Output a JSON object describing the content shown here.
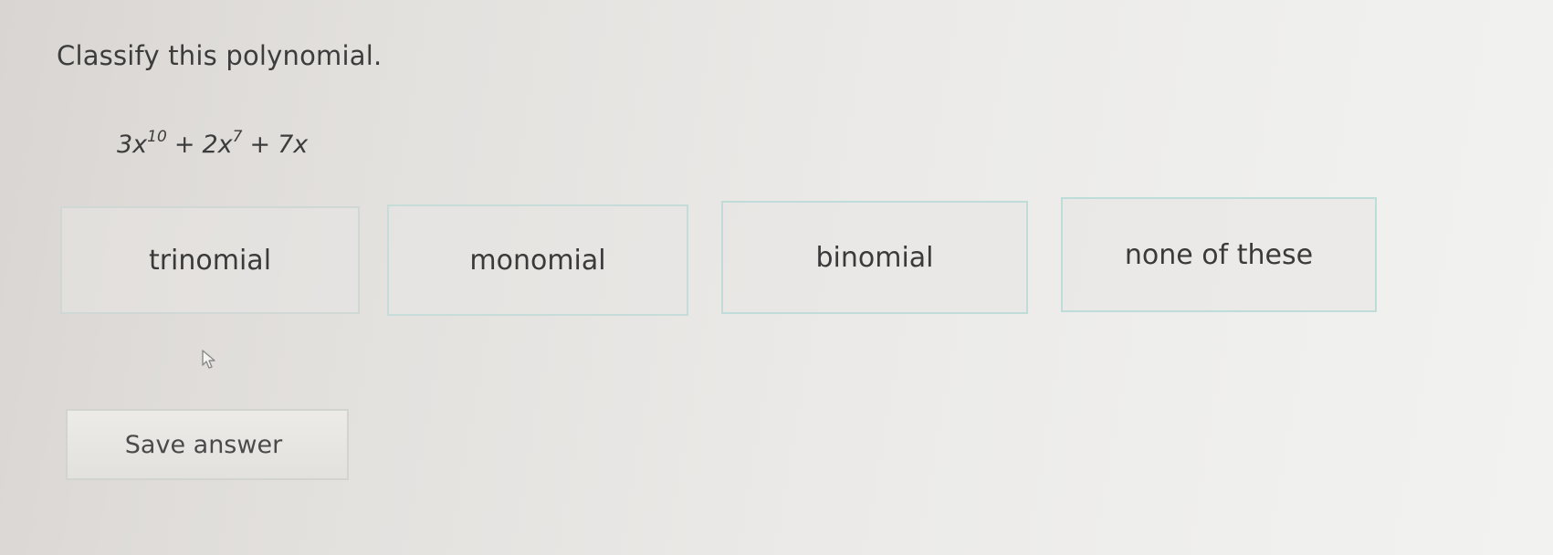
{
  "question": {
    "prompt": "Classify this polynomial."
  },
  "polynomial": {
    "term1_coef": "3x",
    "term1_exp": "10",
    "op1": "+",
    "term2_coef": "2x",
    "term2_exp": "7",
    "op2": "+",
    "term3": "7x"
  },
  "choices": [
    {
      "label": "trinomial"
    },
    {
      "label": "monomial"
    },
    {
      "label": "binomial"
    },
    {
      "label": "none of these"
    }
  ],
  "actions": {
    "save_label": "Save answer"
  },
  "colors": {
    "choice_border": "#c6dcd9",
    "text": "#3a3a3a"
  }
}
